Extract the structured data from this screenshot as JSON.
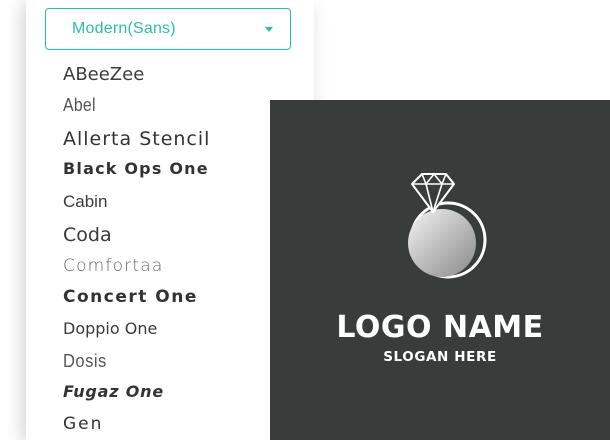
{
  "font_picker": {
    "category_select": {
      "value": "Modern(Sans)",
      "icon": "chevron-down-icon"
    },
    "fonts": [
      "ABeeZee",
      "Abel",
      "Allerta Stencil",
      "Black Ops One",
      "Cabin",
      "Coda",
      "Comfortaa",
      "Concert One",
      "Doppio One",
      "Dosis",
      "Fugaz One",
      "Gen"
    ],
    "accent_color": "#2bbfa8"
  },
  "logo_preview": {
    "background_color": "#383d3c",
    "icon": "diamond-ring-icon",
    "name": "LOGO NAME",
    "slogan": "SLOGAN HERE"
  }
}
